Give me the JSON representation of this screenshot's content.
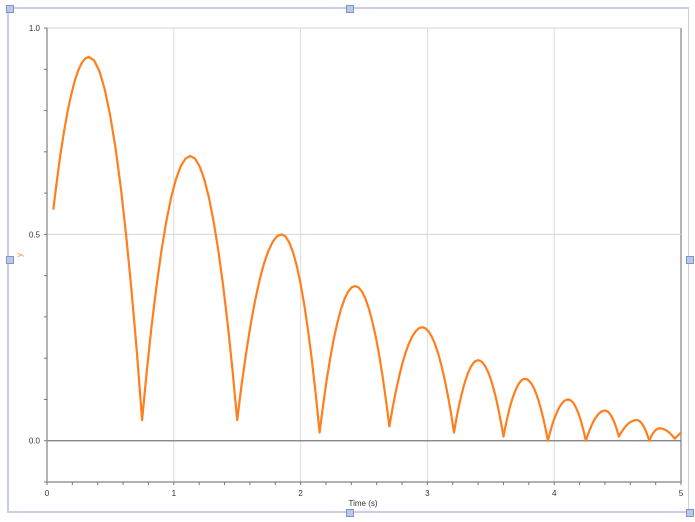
{
  "chart_data": {
    "type": "line",
    "title": "",
    "xlabel": "Time (s)",
    "ylabel": "y",
    "xlim": [
      0,
      5
    ],
    "ylim": [
      -0.1,
      1.0
    ],
    "xticks": [
      "0",
      "1",
      "2",
      "3",
      "4",
      "5"
    ],
    "yticks": [
      "0.0",
      "0.5",
      "1.0"
    ],
    "grid": true,
    "series": [
      {
        "name": "y",
        "color": "#ff7f1e",
        "vertices": [
          {
            "t": 0.05,
            "y": 0.56
          },
          {
            "t": 0.33,
            "y": 0.93
          },
          {
            "t": 0.75,
            "y": 0.05
          },
          {
            "t": 1.13,
            "y": 0.69
          },
          {
            "t": 1.5,
            "y": 0.05
          },
          {
            "t": 1.85,
            "y": 0.5
          },
          {
            "t": 2.15,
            "y": 0.02
          },
          {
            "t": 2.43,
            "y": 0.375
          },
          {
            "t": 2.7,
            "y": 0.035
          },
          {
            "t": 2.96,
            "y": 0.275
          },
          {
            "t": 3.21,
            "y": 0.02
          },
          {
            "t": 3.4,
            "y": 0.195
          },
          {
            "t": 3.6,
            "y": 0.01
          },
          {
            "t": 3.77,
            "y": 0.15
          },
          {
            "t": 3.95,
            "y": 0.0
          },
          {
            "t": 4.11,
            "y": 0.1
          },
          {
            "t": 4.25,
            "y": 0.0
          },
          {
            "t": 4.4,
            "y": 0.073
          },
          {
            "t": 4.51,
            "y": 0.01
          },
          {
            "t": 4.65,
            "y": 0.05
          },
          {
            "t": 4.75,
            "y": 0.0
          },
          {
            "t": 4.83,
            "y": 0.03
          },
          {
            "t": 4.95,
            "y": 0.005
          },
          {
            "t": 5.0,
            "y": 0.02
          }
        ]
      }
    ]
  }
}
